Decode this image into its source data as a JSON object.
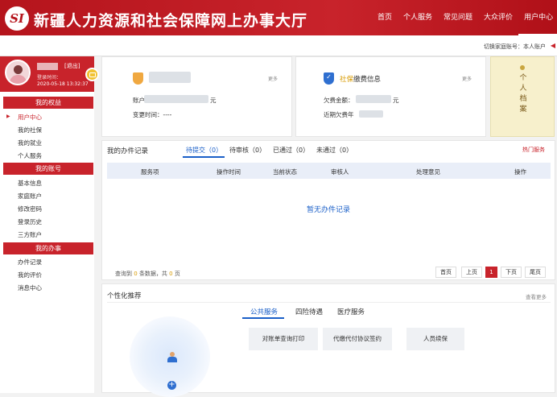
{
  "header": {
    "logo": "SI",
    "title": "新疆人力资源和社会保障网上办事大厅",
    "nav": [
      "首页",
      "个人服务",
      "常见问题",
      "大众评价",
      "用户中心"
    ],
    "active_nav": "用户中心"
  },
  "subbar": {
    "switch_label": "切换家庭账号：本人账户"
  },
  "sidebar": {
    "logout": "[退出]",
    "login_time_label": "登录时间：",
    "login_time": "2020-05-18 13:32:37",
    "sections": [
      {
        "title": "我的权益",
        "items": [
          "用户中心",
          "我的社保",
          "我的就业",
          "个人服务"
        ]
      },
      {
        "title": "我的账号",
        "items": [
          "基本信息",
          "家庭账户",
          "修改密码",
          "登录历史",
          "三方账户"
        ]
      },
      {
        "title": "我的办事",
        "items": [
          "办件记录",
          "我的评价",
          "消息中心"
        ]
      }
    ]
  },
  "cards": {
    "account": {
      "more": "更多",
      "row1_prefix": "账户",
      "row1_suffix": "元",
      "row2": "变更时间：----"
    },
    "social": {
      "title_highlight": "社保",
      "title_rest": "缴费信息",
      "more": "更多",
      "row1": "欠费金额：",
      "row1_suffix": "元",
      "row2": "近期欠费年"
    }
  },
  "side_tab": {
    "text": "个人档案"
  },
  "records": {
    "title": "我的办件记录",
    "tabs": [
      "待提交（0）",
      "待审核（0）",
      "已通过（0）",
      "未通过（0）"
    ],
    "hot_link": "热门服务",
    "columns": [
      "服务项",
      "操作时间",
      "当前状态",
      "审核人",
      "处理意见",
      "操作"
    ],
    "empty": "暂无办件记录",
    "count_prefix": "查询到",
    "count_num": "0",
    "count_suffix": "条数据，共",
    "page_count": "0",
    "page_unit": "页",
    "pager": [
      "首页",
      "上页",
      "1",
      "下页",
      "尾页"
    ]
  },
  "recommend": {
    "title": "个性化推荐",
    "more": "查看更多",
    "tabs": [
      "公共服务",
      "四险待遇",
      "医疗服务"
    ],
    "services": [
      "对账单查询打印",
      "代缴代付协议签约",
      "人员续保"
    ],
    "plus": "+"
  },
  "colors": {
    "brand_red": "#c8232b",
    "link_blue": "#1a5fc8",
    "accent_gold": "#d89a00"
  }
}
